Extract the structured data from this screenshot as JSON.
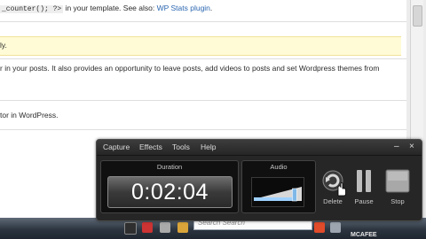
{
  "page": {
    "line1_code": "_counter(); ?>",
    "line1_text": " in your template. See also: ",
    "line1_link": "WP Stats plugin",
    "line1_end": ".",
    "notice_text": "ly.",
    "line3_text": "r in your posts. It also provides an opportunity to leave posts, add videos to posts and set Wordpress themes from",
    "line4_text": "tor in WordPress."
  },
  "recorder": {
    "menu": [
      "Capture",
      "Effects",
      "Tools",
      "Help"
    ],
    "minimize_glyph": "–",
    "close_glyph": "×",
    "duration_label": "Duration",
    "duration_value": "0:02:04",
    "audio_label": "Audio",
    "audio_level": 0.85,
    "buttons": {
      "delete": "Delete",
      "pause": "Pause",
      "stop": "Stop"
    },
    "colors": {
      "window_bg": "#262626",
      "panel_bg": "#101010",
      "text": "#dcdcdc"
    }
  },
  "taskbar": {
    "search_placeholder": "Search Search",
    "tray_text": "MCAFEE"
  }
}
